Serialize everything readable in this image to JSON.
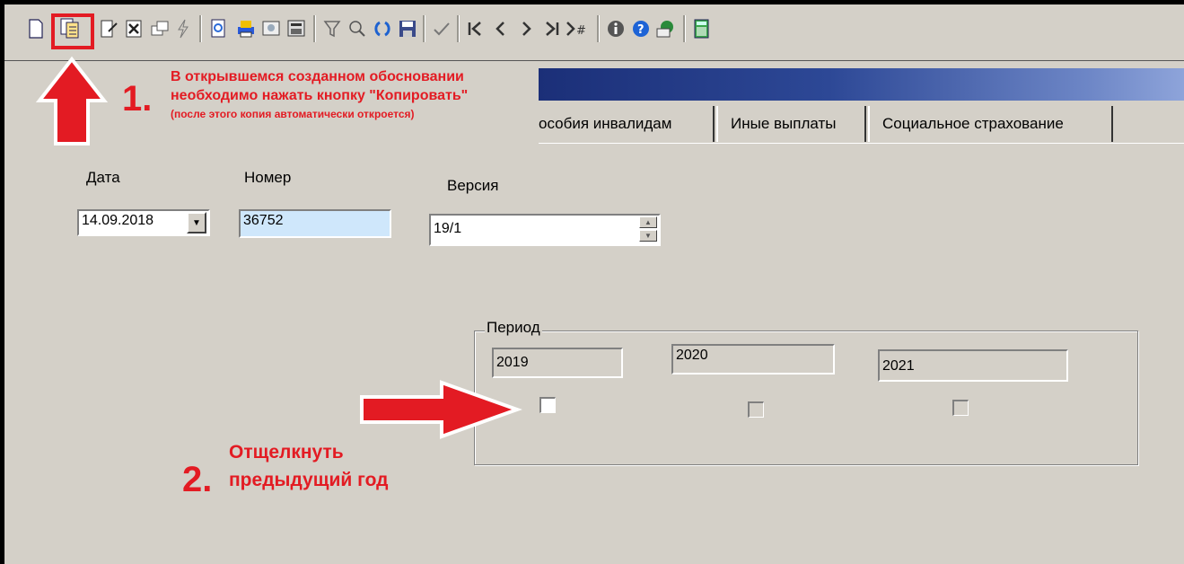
{
  "toolbar": {
    "icons": [
      "new-doc-icon",
      "copy-doc-icon",
      "edit-doc-icon",
      "delete-doc-icon",
      "window-icon",
      "lightning-icon",
      "preview-icon",
      "print-icon",
      "view-icon",
      "calc-window-icon",
      "filter-icon",
      "search-icon",
      "refresh-icon",
      "save-icon",
      "check-icon",
      "first-icon",
      "prev-icon",
      "next-icon",
      "last-icon",
      "goto-number-icon",
      "info-icon",
      "help-icon",
      "mail-icon",
      "calculator-icon"
    ]
  },
  "tabs": [
    "особия инвалидам",
    "Иные выплаты",
    "Социальное страхование"
  ],
  "form": {
    "date_label": "Дата",
    "date_value": "14.09.2018",
    "number_label": "Номер",
    "number_value": "36752",
    "version_label": "Версия",
    "version_value": "19/1"
  },
  "period": {
    "legend": "Период",
    "years": [
      "2019",
      "2020",
      "2021"
    ],
    "checked": [
      false,
      false,
      false
    ]
  },
  "annotations": {
    "step1_number": "1.",
    "step1_line1": "В открывшемся созданном обосновании",
    "step1_line2": "необходимо нажать кнопку \"Копировать\"",
    "step1_line3": "(после этого копия автоматически откроется)",
    "step2_number": "2.",
    "step2_line1": "Отщелкнуть",
    "step2_line2": "предыдущий год"
  },
  "colors": {
    "accent_red": "#e31b23",
    "window_bg": "#d4d0c8",
    "title_blue": "#2d4896",
    "field_blue": "#cfe7fb"
  }
}
